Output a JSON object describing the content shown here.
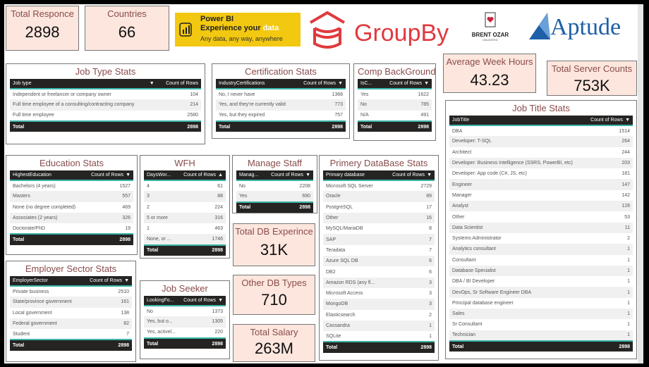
{
  "colors": {
    "title": "#8a4b4b",
    "card_bg": "#fce6dd",
    "header_bg": "#252423",
    "accent": "#3bb6a8",
    "powerbi_yellow": "#f2c811",
    "groupby_red": "#e03a3e",
    "aptude_blue": "#1f5fa8"
  },
  "cards": {
    "total_responce": {
      "label": "Total Responce",
      "value": "2898"
    },
    "countries": {
      "label": "Countries",
      "value": "66"
    },
    "avg_week_hours": {
      "label": "Average Week Hours",
      "value": "43.23"
    },
    "total_server_counts": {
      "label": "Total Server Counts",
      "value": "753K"
    },
    "total_db_exp": {
      "label": "Total DB Experince",
      "value": "31K"
    },
    "other_db_types": {
      "label": "Other DB Types",
      "value": "710"
    },
    "total_salary": {
      "label": "Total Salary",
      "value": "263M"
    }
  },
  "logos": {
    "powerbi": {
      "line1": "Power BI",
      "line2a": "Experience your ",
      "line2b": "data",
      "line3": "Any data, any way, anywhere"
    },
    "groupby": "GroupBy",
    "brentozar": "BRENT OZAR",
    "brentozar_sub": "UNLIMITED",
    "aptude": "Aptude"
  },
  "tables": {
    "jobtype": {
      "title": "Job Type Stats",
      "col1": "Job type",
      "col2": "Count of Rows",
      "sort_on": 1,
      "rows": [
        [
          "Independent or freelancer or company owner",
          "104"
        ],
        [
          "Full time employee of a consulting/contracting company",
          "214"
        ],
        [
          "Full time employee",
          "2580"
        ]
      ],
      "total": [
        "Total",
        "2898"
      ]
    },
    "cert": {
      "title": "Certification Stats",
      "col1": "IndustryCertifications",
      "col2": "Count of Rows",
      "sort_on": 2,
      "rows": [
        [
          "No, I never have",
          "1368"
        ],
        [
          "Yes, and they're currently valid",
          "773"
        ],
        [
          "Yes, but they expired",
          "757"
        ]
      ],
      "total": [
        "Total",
        "2898"
      ]
    },
    "comp": {
      "title": "Comp BackGround",
      "col1": "IsC...",
      "col2": "Count of Rows",
      "sort_on": 2,
      "rows": [
        [
          "Yes",
          "1622"
        ],
        [
          "No",
          "785"
        ],
        [
          "N/A",
          "491"
        ]
      ],
      "total": [
        "Total",
        "2898"
      ]
    },
    "education": {
      "title": "Education Stats",
      "col1": "HighestEducation",
      "col2": "Count of Rows",
      "sort_on": 2,
      "rows": [
        [
          "Bachelors (4 years)",
          "1527"
        ],
        [
          "Masters",
          "557"
        ],
        [
          "None (no degree completed)",
          "469"
        ],
        [
          "Associates (2 years)",
          "326"
        ],
        [
          "Doctorate/PhD",
          "19"
        ]
      ],
      "total": [
        "Total",
        "2898"
      ]
    },
    "wfh": {
      "title": "WFH",
      "col1": "DaysWor...",
      "col2": "Count of Rows",
      "sort_on": 2,
      "sort_dir": "asc",
      "rows": [
        [
          "4",
          "61"
        ],
        [
          "3",
          "88"
        ],
        [
          "2",
          "224"
        ],
        [
          "5 or more",
          "316"
        ],
        [
          "1",
          "463"
        ],
        [
          "None, or ...",
          "1746"
        ]
      ],
      "total": [
        "Total",
        "2898"
      ]
    },
    "manage": {
      "title": "Manage Staff",
      "col1": "Manag...",
      "col2": "Count of Rows",
      "sort_on": 2,
      "rows": [
        [
          "No",
          "2208"
        ],
        [
          "Yes",
          "690"
        ]
      ],
      "total": [
        "Total",
        "2898"
      ]
    },
    "primarydb": {
      "title": "Primery DataBase Stats",
      "col1": "Primary database",
      "col2": "Count of Rows",
      "sort_on": 2,
      "rows": [
        [
          "Microsoft SQL Server",
          "2729"
        ],
        [
          "Oracle",
          "89"
        ],
        [
          "PostgreSQL",
          "17"
        ],
        [
          "Other",
          "16"
        ],
        [
          "MySQL/MariaDB",
          "8"
        ],
        [
          "SAP",
          "7"
        ],
        [
          "Teradata",
          "7"
        ],
        [
          "Azure SQL DB",
          "6"
        ],
        [
          "DB2",
          "6"
        ],
        [
          "Amazon RDS (any fl...",
          "3"
        ],
        [
          "Microsoft Access",
          "3"
        ],
        [
          "MongoDB",
          "3"
        ],
        [
          "Elasticsearch",
          "2"
        ],
        [
          "Cassandra",
          "1"
        ],
        [
          "SQLite",
          "1"
        ]
      ],
      "total": [
        "Total",
        "2898"
      ]
    },
    "employer": {
      "title": "Employer Sector Stats",
      "col1": "EmployerSector",
      "col2": "Count of Rows",
      "sort_on": 2,
      "rows": [
        [
          "Private business",
          "2510"
        ],
        [
          "State/province government",
          "161"
        ],
        [
          "Local government",
          "138"
        ],
        [
          "Federal government",
          "82"
        ],
        [
          "Student",
          "7"
        ]
      ],
      "total": [
        "Total",
        "2898"
      ]
    },
    "jobseeker": {
      "title": "Job Seeker",
      "col1": "LookingFo...",
      "col2": "Count of Rows",
      "sort_on": 2,
      "rows": [
        [
          "No",
          "1373"
        ],
        [
          "Yes, but o...",
          "1305"
        ],
        [
          "Yes, activel...",
          "220"
        ]
      ],
      "total": [
        "Total",
        "2898"
      ]
    },
    "jobtitle": {
      "title": "Job Title Stats",
      "col1": "JobTitle",
      "col2": "Count of Rows",
      "sort_on": 2,
      "rows": [
        [
          "DBA",
          "1514"
        ],
        [
          "Developer: T-SQL",
          "264"
        ],
        [
          "Architect",
          "244"
        ],
        [
          "Developer: Business Intelligence (SSRS, PowerBI, etc)",
          "203"
        ],
        [
          "Developer: App code (C#, JS, etc)",
          "181"
        ],
        [
          "Engineer",
          "147"
        ],
        [
          "Manager",
          "142"
        ],
        [
          "Analyst",
          "128"
        ],
        [
          "Other",
          "53"
        ],
        [
          "Data Scientist",
          "11"
        ],
        [
          "Systems Administrator",
          "2"
        ],
        [
          "Analytics consultant",
          "1"
        ],
        [
          "Consultant",
          "1"
        ],
        [
          "Database Specialist",
          "1"
        ],
        [
          "DBA / BI Developer",
          "1"
        ],
        [
          "DevOps, Sr Software Engineer DBA",
          "1"
        ],
        [
          "Principal database engineer",
          "1"
        ],
        [
          "Sales",
          "1"
        ],
        [
          "Sr Consultant",
          "1"
        ],
        [
          "Technician",
          "1"
        ]
      ],
      "total": [
        "Total",
        "2898"
      ]
    }
  }
}
